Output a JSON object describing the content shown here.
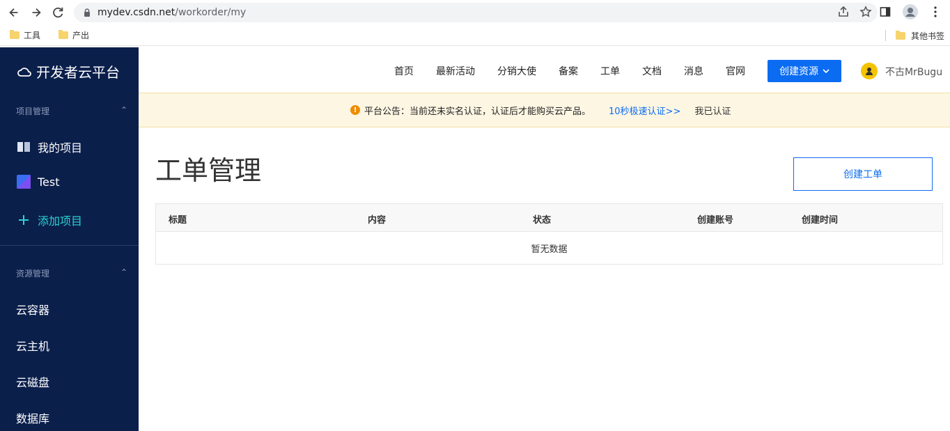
{
  "browser": {
    "url_host": "mydev.csdn.net",
    "url_path": "/workorder/my",
    "bookmarks": [
      "工具",
      "产出"
    ],
    "other_bookmarks": "其他书签"
  },
  "sidebar": {
    "logo": "开发者云平台",
    "section_projects": "项目管理",
    "items_projects": [
      "我的项目",
      "Test",
      "添加项目"
    ],
    "section_resources": "资源管理",
    "items_resources": [
      "云容器",
      "云主机",
      "云磁盘",
      "数据库"
    ]
  },
  "topnav": {
    "links": [
      "首页",
      "最新活动",
      "分销大使",
      "备案",
      "工单",
      "文档",
      "消息",
      "官网"
    ],
    "create_resource": "创建资源",
    "username": "不古MrBugu"
  },
  "notice": {
    "text": "平台公告：当前还未实名认证，认证后才能购买云产品。",
    "link": "10秒极速认证>>",
    "done": "我已认证"
  },
  "main": {
    "title": "工单管理",
    "create_ticket": "创建工单",
    "columns": [
      "标题",
      "内容",
      "状态",
      "创建账号",
      "创建时间"
    ],
    "empty": "暂无数据"
  },
  "colors": {
    "sidebar_bg": "#0b1f4b",
    "accent": "#0b6cf2",
    "add_project": "#2ad3d3",
    "notice_bg": "#fdf6e3"
  }
}
